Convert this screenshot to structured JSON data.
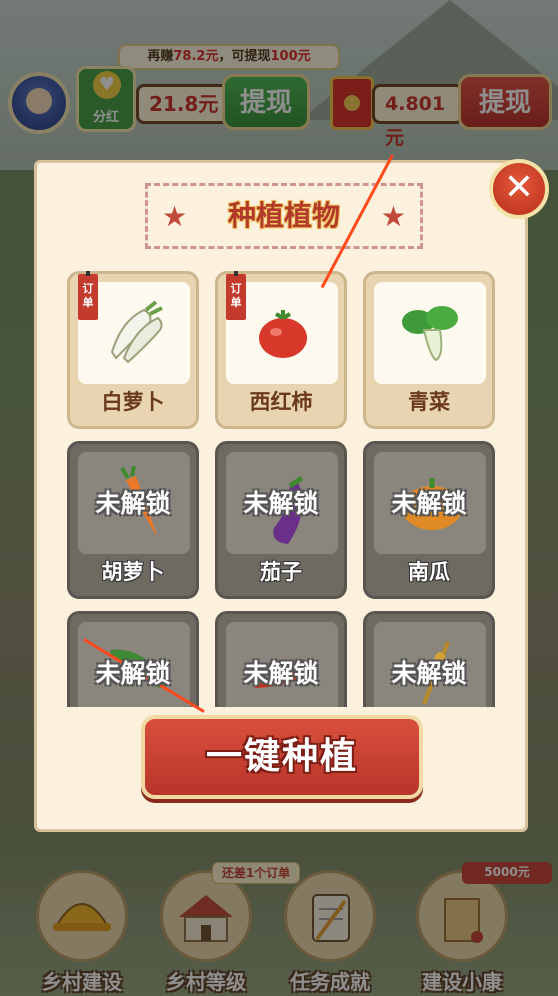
{
  "hud": {
    "tip_prefix": "再赚",
    "tip_amount": "78.2元",
    "tip_middle": "，可提现",
    "tip_target": "100元",
    "bonus_label": "分红",
    "bonus_amount": "21.8元",
    "withdraw_label_1": "提现",
    "redpack_amount": "4.801元",
    "withdraw_label_2": "提现"
  },
  "dialog": {
    "title": "种植植物",
    "close_symbol": "✕",
    "locked_text": "未解锁",
    "order_tag": "订单",
    "crops": [
      {
        "name": "白萝卜",
        "locked": false,
        "order": true,
        "icon": "white-radish-icon"
      },
      {
        "name": "西红柿",
        "locked": false,
        "order": true,
        "icon": "tomato-icon"
      },
      {
        "name": "青菜",
        "locked": false,
        "order": false,
        "icon": "bok-choy-icon"
      },
      {
        "name": "胡萝卜",
        "locked": true,
        "order": false,
        "icon": "carrot-icon"
      },
      {
        "name": "茄子",
        "locked": true,
        "order": false,
        "icon": "eggplant-icon"
      },
      {
        "name": "南瓜",
        "locked": true,
        "order": false,
        "icon": "pumpkin-icon"
      },
      {
        "name": "",
        "locked": true,
        "order": false,
        "icon": "cucumber-icon"
      },
      {
        "name": "",
        "locked": true,
        "order": false,
        "icon": "chili-icon"
      },
      {
        "name": "",
        "locked": true,
        "order": false,
        "icon": "wheat-icon"
      }
    ],
    "plant_all_label": "一键种植"
  },
  "nav": {
    "items": [
      {
        "label": "乡村建设",
        "icon": "helmet-icon"
      },
      {
        "label": "乡村等级",
        "icon": "house-icon"
      },
      {
        "label": "任务成就",
        "icon": "clipboard-icon"
      },
      {
        "label": "建设小康",
        "icon": "scroll-icon"
      }
    ],
    "level_tag": "还差1个订单",
    "reward_tag": "5000元"
  },
  "colors": {
    "accent_red": "#c53a24",
    "dialog_bg": "#fbf1dd",
    "green": "#3c9a3b"
  }
}
